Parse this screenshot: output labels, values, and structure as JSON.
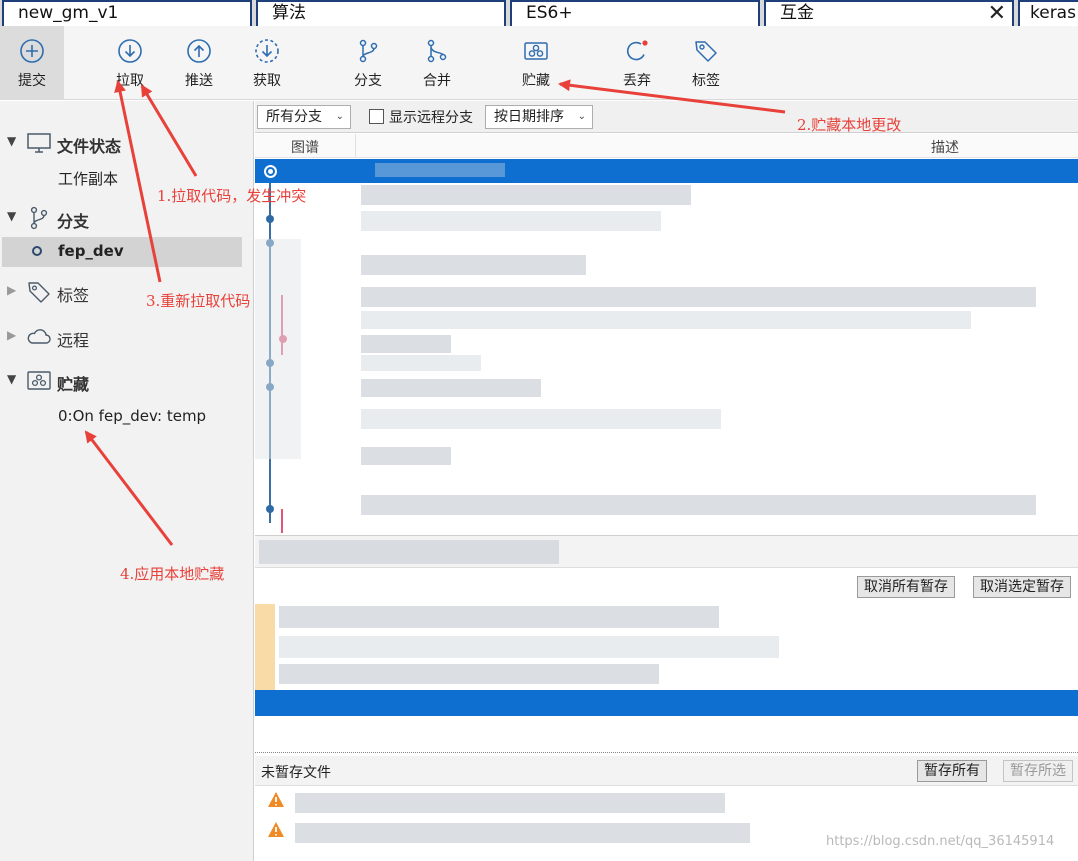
{
  "tabs": [
    {
      "label": "new_gm_v1"
    },
    {
      "label": "算法"
    },
    {
      "label": "ES6+"
    },
    {
      "label": "互金",
      "close": "✕"
    },
    {
      "label": "keras"
    }
  ],
  "toolbar": {
    "commit": "提交",
    "pull": "拉取",
    "push": "推送",
    "fetch": "获取",
    "branch": "分支",
    "merge": "合并",
    "stash": "贮藏",
    "discard": "丢弃",
    "tag": "标签"
  },
  "sidebar": {
    "file_status": "文件状态",
    "working_copy": "工作副本",
    "branches": "分支",
    "current_branch": "fep_dev",
    "tags": "标签",
    "remotes": "远程",
    "stashes": "贮藏",
    "stash_item": "0:On fep_dev: temp"
  },
  "filters": {
    "branch_select": "所有分支",
    "show_remote": "显示远程分支",
    "sort_select": "按日期排序"
  },
  "columns": {
    "graph": "图谱",
    "description": "描述"
  },
  "staged": {
    "unstage_all": "取消所有暂存",
    "unstage_selected": "取消选定暂存"
  },
  "unstaged": {
    "title": "未暂存文件",
    "stage_all": "暂存所有",
    "stage_selected": "暂存所选"
  },
  "annotations": {
    "a1": "1.拉取代码，发生冲突",
    "a2": "2.贮藏本地更改",
    "a3": "3.重新拉取代码",
    "a4": "4.应用本地贮藏"
  },
  "watermark": "https://blog.csdn.net/qq_36145914",
  "colors": {
    "accent": "#0e6fd1",
    "annotation": "#e8413a",
    "tab_border": "#1f3f7a"
  }
}
